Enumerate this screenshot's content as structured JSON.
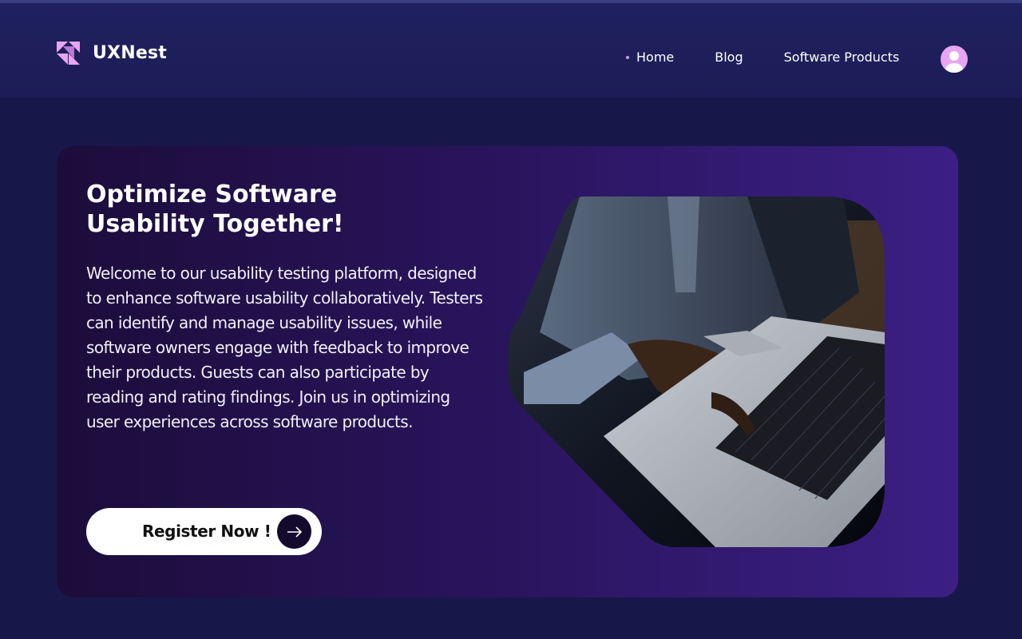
{
  "brand": {
    "name": "UXNest",
    "logo_icon": "uxnest-logo-icon",
    "accent": "#e7a6f2"
  },
  "nav": {
    "items": [
      {
        "label": "Home",
        "active": true
      },
      {
        "label": "Blog",
        "active": false
      },
      {
        "label": "Software Products",
        "active": false
      }
    ],
    "avatar_icon": "user-avatar-icon"
  },
  "hero": {
    "title_line1": "Optimize Software",
    "title_line2": "Usability Together!",
    "description": "Welcome to our usability testing platform, designed to enhance software usability collaboratively. Testers can identify and manage usability issues, while software owners engage with feedback to improve their products. Guests can also participate by reading and rating findings. Join us in optimizing user experiences across software products.",
    "cta_label": "Register Now !",
    "cta_icon": "arrow-right-icon",
    "image_subject": "laptop-typing-photo"
  },
  "colors": {
    "background": "#18174a",
    "header": "#1e205c",
    "hero_gradient_start": "#1b0d3a",
    "hero_gradient_end": "#3c1f84",
    "button": "#ffffff"
  }
}
